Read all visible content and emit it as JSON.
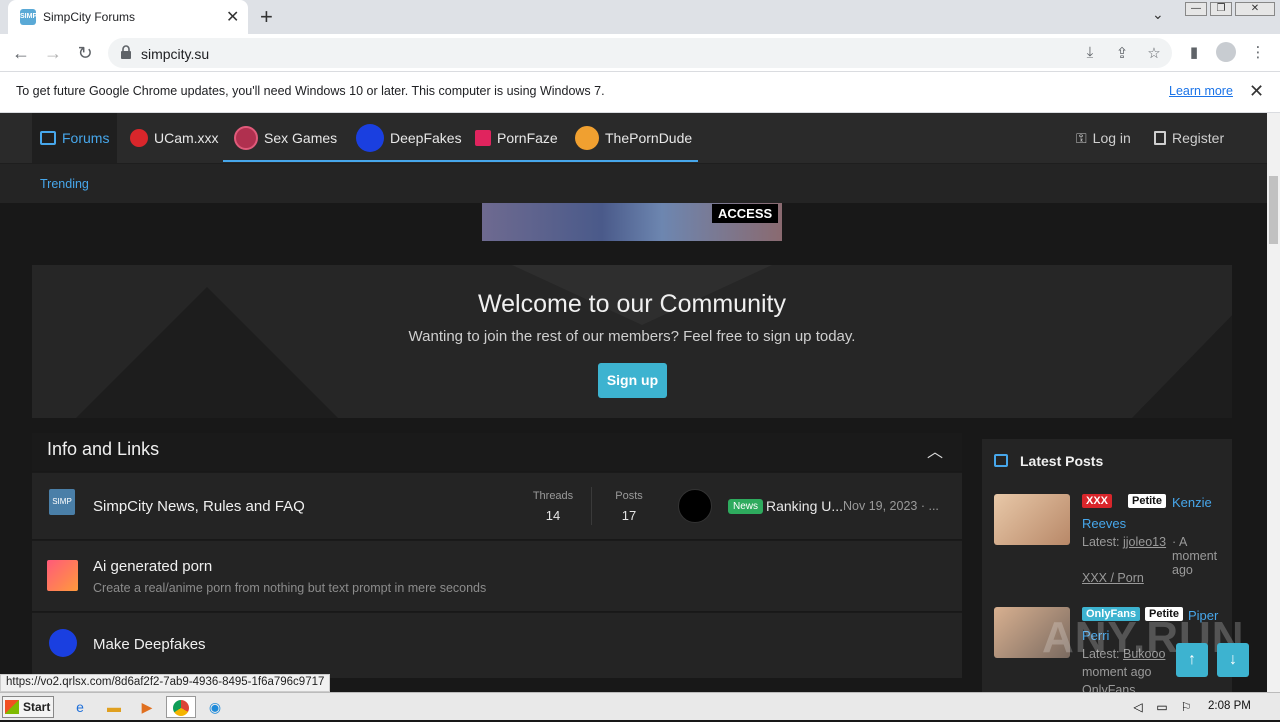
{
  "browser": {
    "tab_title": "SimpCity Forums",
    "url": "simpcity.su",
    "infobar_text": "To get future Google Chrome updates, you'll need Windows 10 or later. This computer is using Windows 7.",
    "learn_more": "Learn more"
  },
  "nav": {
    "items": [
      {
        "label": "Forums",
        "icon": "forum-icon",
        "color": "#47a7eb"
      },
      {
        "label": "UCam.xxx",
        "icon": "ucam-logo-icon",
        "color": "#d9262b"
      },
      {
        "label": "Sex Games",
        "icon": "sex-games-logo-icon",
        "color": "#b0304f"
      },
      {
        "label": "DeepFakes",
        "icon": "deepfakes-logo-icon",
        "color": "#1a3fe0"
      },
      {
        "label": "PornFaze",
        "icon": "pornfaze-logo-icon",
        "color": "#e0245e"
      },
      {
        "label": "ThePornDude",
        "icon": "theporndude-logo-icon",
        "color": "#f0a030"
      }
    ],
    "login": "Log in",
    "register": "Register",
    "trending": "Trending"
  },
  "banner": {
    "text": "ACCESS"
  },
  "welcome": {
    "title": "Welcome to our Community",
    "subtitle": "Wanting to join the rest of our members? Feel free to sign up today.",
    "button": "Sign up"
  },
  "info": {
    "title": "Info and Links",
    "forums": [
      {
        "title": "SimpCity News, Rules and FAQ",
        "threads_label": "Threads",
        "threads": "14",
        "posts_label": "Posts",
        "posts": "17",
        "tag": "News",
        "latest": "Ranking U...",
        "date": "Nov 19, 2023 · ..."
      },
      {
        "title": "Ai generated porn",
        "desc": "Create a real/anime porn from nothing but text prompt in mere seconds"
      },
      {
        "title": "Make Deepfakes"
      }
    ]
  },
  "latest_posts": {
    "title": "Latest Posts",
    "posts": [
      {
        "tags": [
          "XXX",
          "Petite"
        ],
        "title_line1": "Kenzie",
        "title_line2": "Reeves",
        "latest_label": "Latest:",
        "user": "jjoleo13",
        "time": "· A moment ago",
        "forum": "XXX / Porn"
      },
      {
        "tags": [
          "OnlyFans",
          "Petite"
        ],
        "title_line1": "Piper",
        "title_line2": "Perri",
        "latest_label": "Latest:",
        "user": "Bukooo",
        "time": "moment ago",
        "forum": "OnlyFans"
      }
    ]
  },
  "status_url": "https://vo2.qrlsx.com/8d6af2f2-7ab9-4936-8495-1f6a796c9717",
  "taskbar": {
    "start": "Start",
    "clock": "2:08 PM"
  },
  "watermark": "ANY.RUN"
}
